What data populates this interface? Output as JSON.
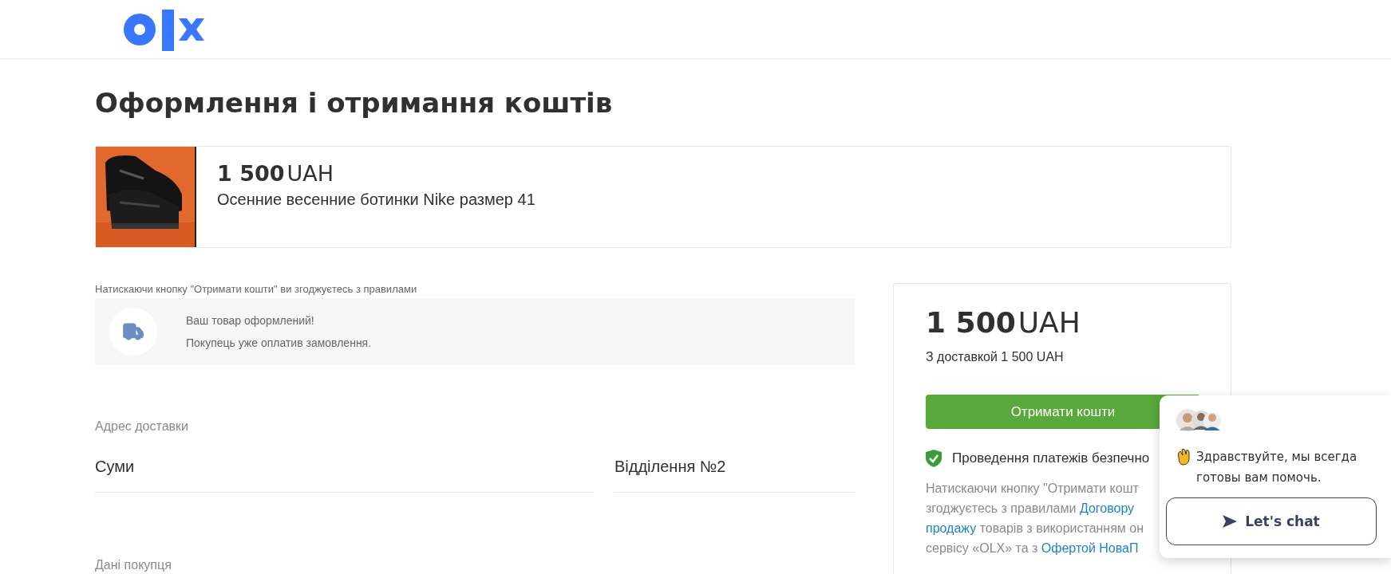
{
  "page_title": "Оформлення і отримання коштів",
  "product": {
    "amount": "1 500",
    "currency": "UAH",
    "name": "Осенние весенние ботинки Nike размер 41"
  },
  "agreement_note": "Натискаючи кнопку \"Отримати кошти\" ви згоджуєтесь з правилами",
  "notice": {
    "title": "Ваш товар оформлений!",
    "text": "Покупець уже оплатив замовлення."
  },
  "delivery": {
    "label": "Адрес доставки",
    "fields": [
      {
        "value": "Суми"
      },
      {
        "value": "Відділення №2"
      }
    ]
  },
  "buyer": {
    "label": "Дані покупця"
  },
  "summary": {
    "amount": "1 500",
    "currency": "UAH",
    "with_delivery": "З доставкой 1 500 UAH",
    "button": "Отримати кошти",
    "secure": "Проведення платежів безпечно",
    "terms_lines": [
      [
        {
          "text": "Натискаючи кнопку \"Отримати кошт",
          "link": false
        }
      ],
      [
        {
          "text": "згоджуєтесь з правилами ",
          "link": false
        },
        {
          "text": "Договору",
          "link": true
        }
      ],
      [
        {
          "text": "продажу",
          "link": true
        },
        {
          "text": " товарів з використанням он",
          "link": false
        }
      ],
      [
        {
          "text": "сервісу «OLX» та з ",
          "link": false
        },
        {
          "text": "Офертой НоваП",
          "link": true
        }
      ]
    ]
  },
  "chat_widget": {
    "greeting": "Здравствуйте, мы всегда готовы вам помочь.",
    "button": "Let's chat"
  }
}
